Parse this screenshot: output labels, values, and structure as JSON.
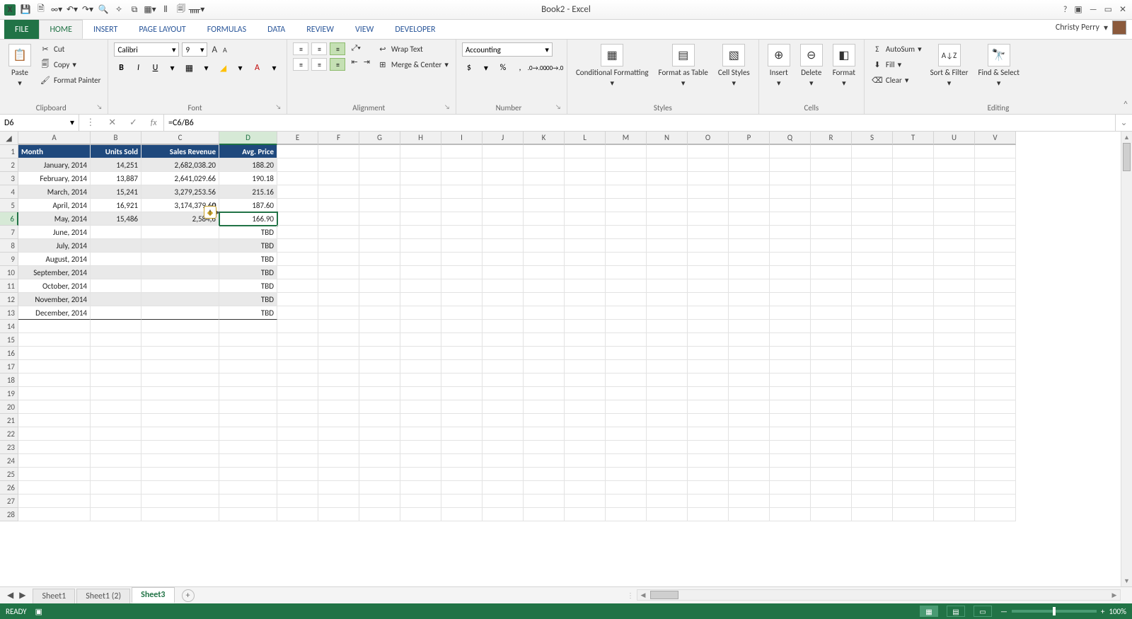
{
  "app": {
    "title": "Book2 - Excel",
    "user": "Christy Perry"
  },
  "titlebar_icons": [
    "excel",
    "save",
    "save-as",
    "infinity",
    "undo",
    "redo",
    "find",
    "new",
    "open",
    "window",
    "align",
    "print",
    "macros"
  ],
  "window_ctrls": [
    "?",
    "▢",
    "—",
    "▭",
    "✕"
  ],
  "tabs": {
    "file": "FILE",
    "items": [
      "HOME",
      "INSERT",
      "PAGE LAYOUT",
      "FORMULAS",
      "DATA",
      "REVIEW",
      "VIEW",
      "DEVELOPER"
    ],
    "active": "HOME"
  },
  "ribbon": {
    "clipboard": {
      "label": "Clipboard",
      "paste": "Paste",
      "cut": "Cut",
      "copy": "Copy",
      "fmt": "Format Painter"
    },
    "font": {
      "label": "Font",
      "name": "Calibri",
      "size": "9",
      "bold": "B",
      "italic": "I",
      "underline": "U"
    },
    "alignment": {
      "label": "Alignment",
      "wrap": "Wrap Text",
      "merge": "Merge & Center"
    },
    "number": {
      "label": "Number",
      "format": "Accounting"
    },
    "styles": {
      "label": "Styles",
      "cond": "Conditional Formatting",
      "fmtas": "Format as Table",
      "cell": "Cell Styles"
    },
    "cells": {
      "label": "Cells",
      "insert": "Insert",
      "delete": "Delete",
      "format": "Format"
    },
    "editing": {
      "label": "Editing",
      "autosum": "AutoSum",
      "fill": "Fill",
      "clear": "Clear",
      "sort": "Sort & Filter",
      "find": "Find & Select"
    }
  },
  "formula_bar": {
    "name": "D6",
    "formula": "=C6/B6"
  },
  "grid": {
    "columns": [
      "A",
      "B",
      "C",
      "D",
      "E",
      "F",
      "G",
      "H",
      "I",
      "J",
      "K",
      "L",
      "M",
      "N",
      "O",
      "P",
      "Q",
      "R",
      "S",
      "T",
      "U",
      "V"
    ],
    "selected_col_index": 3,
    "selected_row": 6,
    "headers": [
      "Month",
      "Units Sold",
      "Sales Revenue",
      "Avg. Price"
    ],
    "rows": [
      {
        "a": "January, 2014",
        "b": "14,251",
        "c": "2,682,038.20",
        "d": "188.20"
      },
      {
        "a": "February, 2014",
        "b": "13,887",
        "c": "2,641,029.66",
        "d": "190.18"
      },
      {
        "a": "March, 2014",
        "b": "15,241",
        "c": "3,279,253.56",
        "d": "215.16"
      },
      {
        "a": "April, 2014",
        "b": "16,921",
        "c": "3,174,379.60",
        "d": "187.60"
      },
      {
        "a": "May, 2014",
        "b": "15,486",
        "c": "2,584,6",
        "c_trail": "0",
        "d": "166.90"
      },
      {
        "a": "June, 2014",
        "b": "",
        "c": "",
        "d": "TBD"
      },
      {
        "a": "July, 2014",
        "b": "",
        "c": "",
        "d": "TBD"
      },
      {
        "a": "August, 2014",
        "b": "",
        "c": "",
        "d": "TBD"
      },
      {
        "a": "September, 2014",
        "b": "",
        "c": "",
        "d": "TBD"
      },
      {
        "a": "October, 2014",
        "b": "",
        "c": "",
        "d": "TBD"
      },
      {
        "a": "November, 2014",
        "b": "",
        "c": "",
        "d": "TBD"
      },
      {
        "a": "December, 2014",
        "b": "",
        "c": "",
        "d": "TBD"
      }
    ],
    "active_cell": "D6",
    "error_indicator_cell": "C6"
  },
  "sheets": {
    "items": [
      "Sheet1",
      "Sheet1 (2)",
      "Sheet3"
    ],
    "active": 2
  },
  "status": {
    "ready": "READY",
    "zoom": "100%"
  }
}
